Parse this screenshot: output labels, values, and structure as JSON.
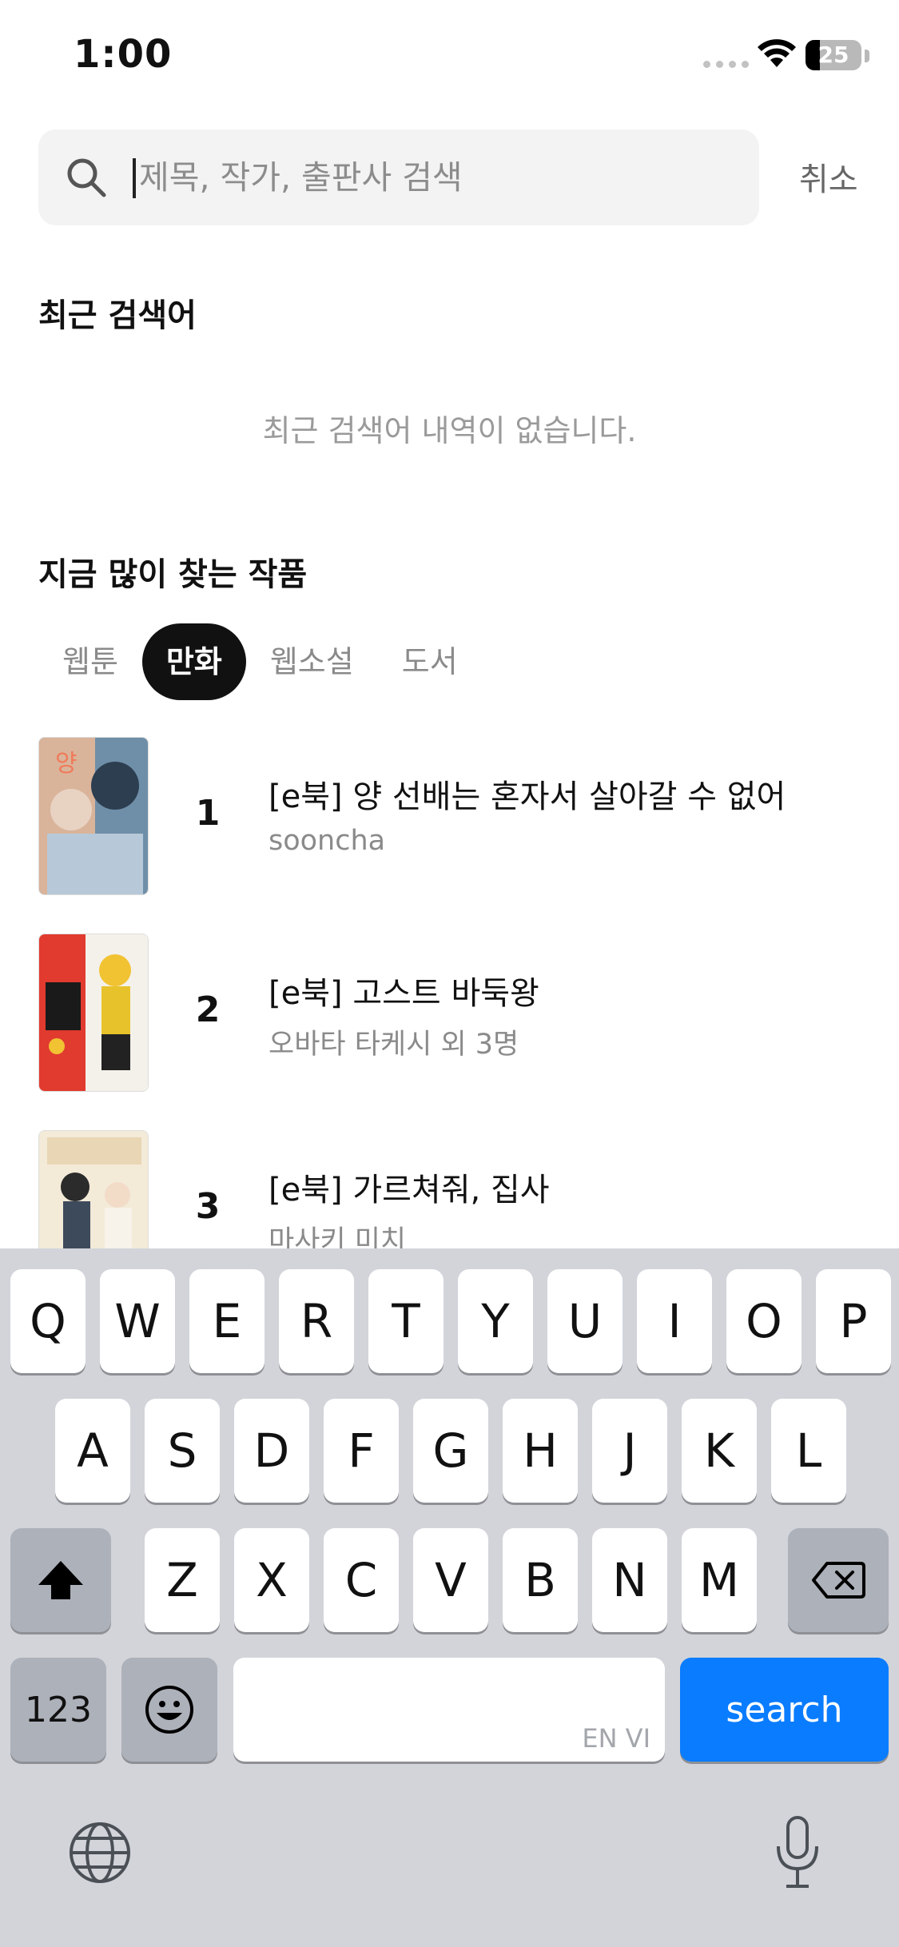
{
  "status_bar": {
    "time": "1:00",
    "battery": "25",
    "battery_level": 0.25
  },
  "search": {
    "placeholder": "제목, 작가, 출판사 검색",
    "value": "",
    "cancel_label": "취소"
  },
  "recent": {
    "title": "최근 검색어",
    "empty_message": "최근 검색어 내역이 없습니다."
  },
  "popular": {
    "title": "지금 많이 찾는 작품",
    "tabs": [
      {
        "label": "웹툰",
        "active": false
      },
      {
        "label": "만화",
        "active": true
      },
      {
        "label": "웹소설",
        "active": false
      },
      {
        "label": "도서",
        "active": false
      }
    ],
    "items": [
      {
        "rank": "1",
        "title": "[e북] 양 선배는 혼자서 살아갈 수 없어",
        "author": "sooncha"
      },
      {
        "rank": "2",
        "title": "[e북] 고스트 바둑왕",
        "author": "오바타 타케시 외 3명"
      },
      {
        "rank": "3",
        "title": "[e북] 가르쳐줘, 집사",
        "author": "마사키 미치"
      }
    ]
  },
  "keyboard": {
    "row1": [
      "Q",
      "W",
      "E",
      "R",
      "T",
      "Y",
      "U",
      "I",
      "O",
      "P"
    ],
    "row2": [
      "A",
      "S",
      "D",
      "F",
      "G",
      "H",
      "J",
      "K",
      "L"
    ],
    "row3": [
      "Z",
      "X",
      "C",
      "V",
      "B",
      "N",
      "M"
    ],
    "numbers_label": "123",
    "search_label": "search",
    "lang_hint": "EN VI"
  },
  "icons": {
    "search": "search-icon",
    "wifi": "wifi-icon",
    "shift": "shift-icon",
    "delete": "backspace-icon",
    "emoji": "emoji-icon",
    "globe": "globe-icon",
    "mic": "microphone-icon"
  },
  "colors": {
    "accent": "#0a7cff",
    "active_tab": "#111111",
    "keyboard_bg": "#d2d4da"
  }
}
